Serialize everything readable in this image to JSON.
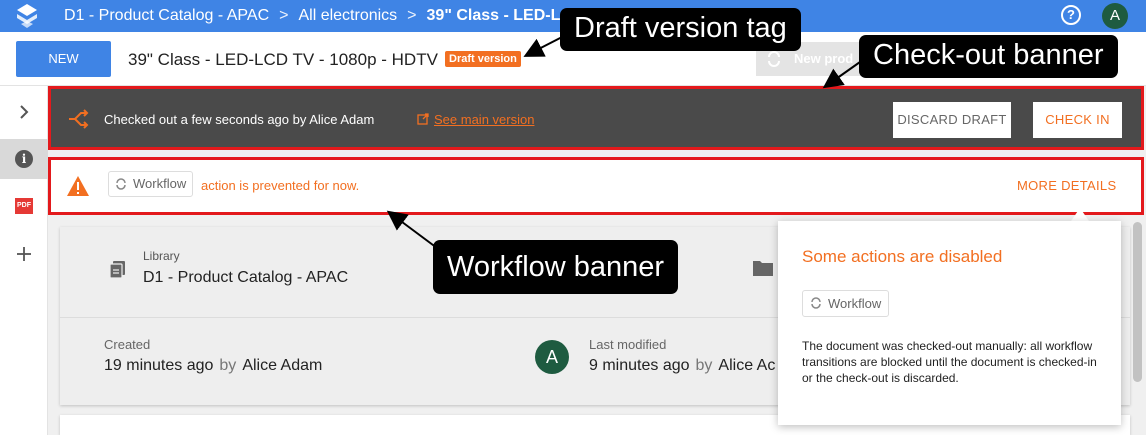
{
  "topbar": {
    "breadcrumbs": [
      "D1 - Product Catalog - APAC",
      "All electronics"
    ],
    "current": "39\" Class - LED-L",
    "separator": ">",
    "help_glyph": "?",
    "avatar_initial": "A"
  },
  "header": {
    "new_label": "NEW",
    "title": "39\" Class - LED-LCD TV - 1080p - HDTV",
    "draft_tag": "Draft version",
    "new_product_label": "New prod"
  },
  "checkout_banner": {
    "message": "Checked out a few seconds ago by Alice Adam",
    "link": "See main version",
    "discard_label": "DISCARD DRAFT",
    "checkin_label": "CHECK IN"
  },
  "workflow_banner": {
    "chip": "Workflow",
    "message": "action is prevented for now.",
    "more_details": "MORE DETAILS"
  },
  "card": {
    "library_label": "Library",
    "library_value": "D1 - Product Catalog - APAC",
    "created_label": "Created",
    "created_time": "19 minutes ago",
    "created_by_word": "by",
    "created_user": "Alice Adam",
    "modified_label": "Last modified",
    "modified_time": "9 minutes ago",
    "modified_by_word": "by",
    "modified_user": "Alice Ac",
    "avatar_initial": "A"
  },
  "popover": {
    "title": "Some actions are disabled",
    "chip": "Workflow",
    "description": "The document was checked-out manually: all workflow transitions are blocked until the document is checked-in or the check-out is discarded."
  },
  "rail": {
    "pdf_label": "PDF"
  },
  "annotations": {
    "draft": "Draft version tag",
    "checkout": "Check-out banner",
    "workflow": "Workflow banner"
  },
  "colors": {
    "topbar": "#3f84e5",
    "accent_orange": "#f26f21",
    "banner_dark": "#4a4a4a",
    "highlight_red": "#e3191c",
    "avatar_green": "#1e5b40"
  },
  "icons": [
    "logo-icon",
    "help-icon",
    "chevron-right-icon",
    "info-icon",
    "pdf-icon",
    "add-icon",
    "checkout-icon",
    "external-link-icon",
    "warning-icon",
    "workflow-icon",
    "library-icon",
    "folder-icon"
  ]
}
